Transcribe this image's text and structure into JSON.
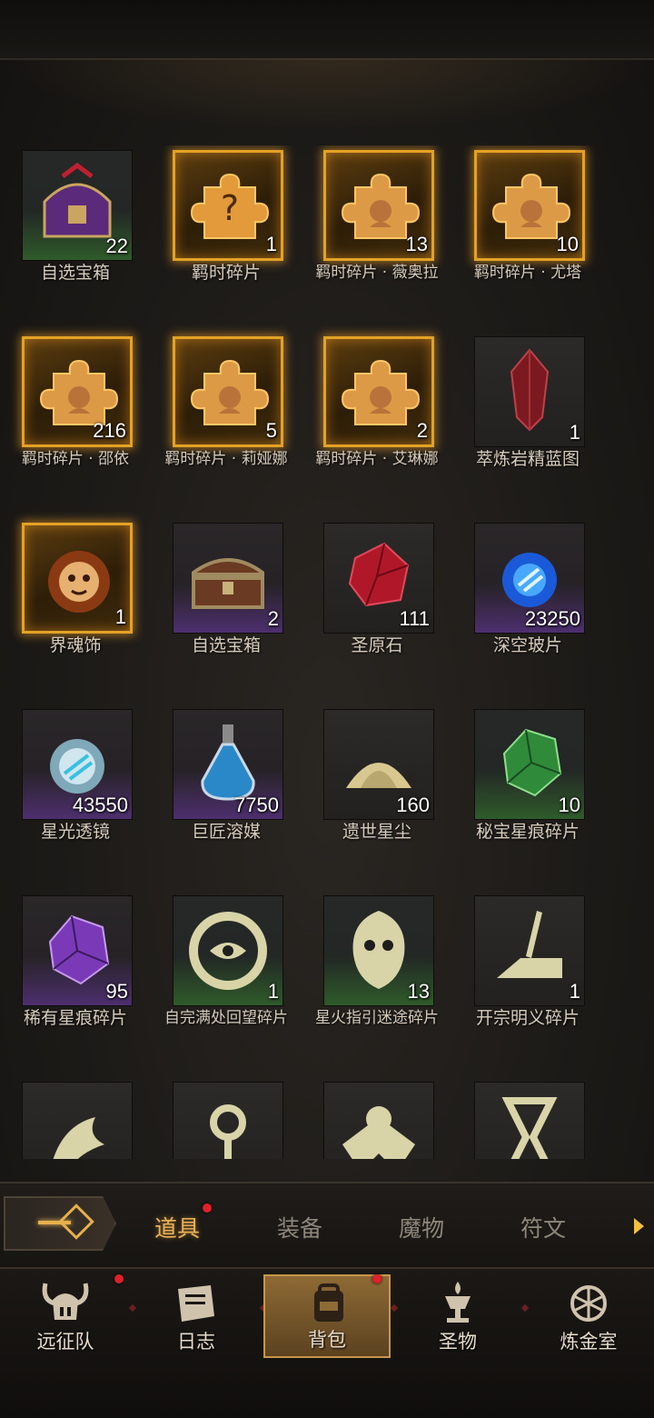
{
  "items": [
    {
      "name": "自选宝箱",
      "count": "22",
      "rarity": "green",
      "icon": "chest-purple-icon"
    },
    {
      "name": "羁时碎片",
      "count": "1",
      "rarity": "gold",
      "icon": "puzzle-question-icon"
    },
    {
      "name": "羁时碎片 · 薇奥拉",
      "count": "13",
      "rarity": "gold",
      "icon": "puzzle-portrait-icon"
    },
    {
      "name": "羁时碎片 · 尤塔",
      "count": "10",
      "rarity": "gold",
      "icon": "puzzle-portrait-icon"
    },
    {
      "name": "羁时碎片 · 邵依",
      "count": "216",
      "rarity": "gold",
      "icon": "puzzle-portrait-icon"
    },
    {
      "name": "羁时碎片 · 莉娅娜",
      "count": "5",
      "rarity": "gold",
      "icon": "puzzle-portrait-icon"
    },
    {
      "name": "羁时碎片 · 艾琳娜",
      "count": "2",
      "rarity": "gold",
      "icon": "puzzle-portrait-icon"
    },
    {
      "name": "萃炼岩精蓝图",
      "count": "1",
      "rarity": "neutral",
      "icon": "red-crystal-icon"
    },
    {
      "name": "界魂饰",
      "count": "1",
      "rarity": "gold",
      "icon": "sun-mask-icon"
    },
    {
      "name": "自选宝箱",
      "count": "2",
      "rarity": "purple",
      "icon": "wooden-chest-icon"
    },
    {
      "name": "圣原石",
      "count": "111",
      "rarity": "neutral",
      "icon": "ruby-gem-icon"
    },
    {
      "name": "深空玻片",
      "count": "23250",
      "rarity": "purple",
      "icon": "blue-orb-icon"
    },
    {
      "name": "星光透镜",
      "count": "43550",
      "rarity": "purple",
      "icon": "crystal-orb-icon"
    },
    {
      "name": "巨匠溶媒",
      "count": "7750",
      "rarity": "purple",
      "icon": "potion-flask-icon"
    },
    {
      "name": "遗世星尘",
      "count": "160",
      "rarity": "neutral",
      "icon": "dust-pile-icon"
    },
    {
      "name": "秘宝星痕碎片",
      "count": "10",
      "rarity": "green",
      "icon": "green-shard-icon"
    },
    {
      "name": "稀有星痕碎片",
      "count": "95",
      "rarity": "purple",
      "icon": "purple-shard-icon"
    },
    {
      "name": "自完满处回望碎片",
      "count": "1",
      "rarity": "green",
      "icon": "eye-rune-icon"
    },
    {
      "name": "星火指引迷途碎片",
      "count": "13",
      "rarity": "green",
      "icon": "mask-rune-icon"
    },
    {
      "name": "开宗明义碎片",
      "count": "1",
      "rarity": "neutral",
      "icon": "quill-rune-icon"
    },
    {
      "name": "",
      "count": "",
      "rarity": "neutral",
      "icon": "dragon-rune-icon"
    },
    {
      "name": "",
      "count": "",
      "rarity": "neutral",
      "icon": "key-rune-icon"
    },
    {
      "name": "",
      "count": "",
      "rarity": "neutral",
      "icon": "wings-rune-icon"
    },
    {
      "name": "",
      "count": "",
      "rarity": "neutral",
      "icon": "hourglass-rune-icon"
    }
  ],
  "tabs": [
    {
      "label": "道具",
      "active": true,
      "badge": true
    },
    {
      "label": "装备",
      "active": false,
      "badge": false
    },
    {
      "label": "魔物",
      "active": false,
      "badge": false
    },
    {
      "label": "符文",
      "active": false,
      "badge": false
    }
  ],
  "nav": [
    {
      "label": "远征队",
      "icon": "horned-helmet-icon",
      "badge": true,
      "active": false
    },
    {
      "label": "日志",
      "icon": "scroll-icon",
      "badge": false,
      "active": false
    },
    {
      "label": "背包",
      "icon": "backpack-icon",
      "badge": true,
      "active": true
    },
    {
      "label": "圣物",
      "icon": "chalice-icon",
      "badge": false,
      "active": false
    },
    {
      "label": "炼金室",
      "icon": "alchemy-icon",
      "badge": false,
      "active": false
    }
  ],
  "colors": {
    "gold_border": "#e3a226",
    "active_tab": "#eab35a",
    "badge_red": "#e0202a"
  }
}
